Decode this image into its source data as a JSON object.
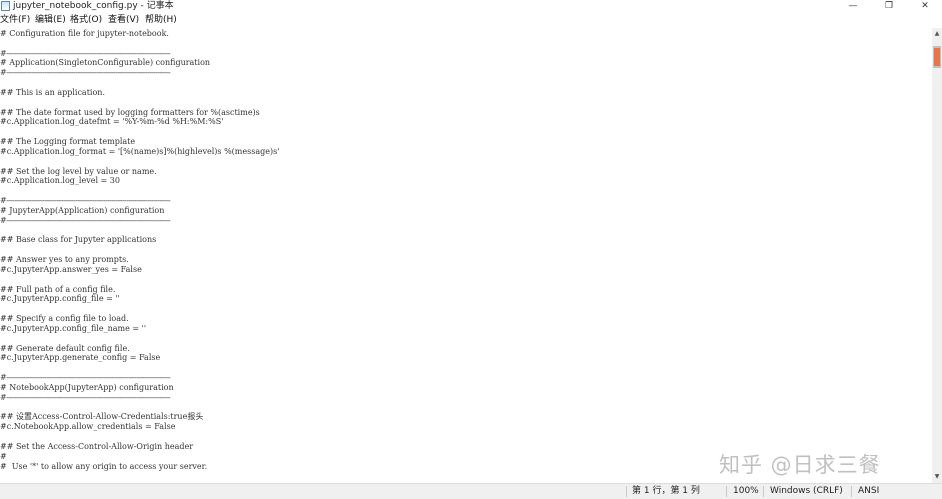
{
  "window": {
    "title": "jupyter_notebook_config.py - 记事本",
    "icon": "notepad-icon",
    "controls": {
      "minimize": "—",
      "maximize": "❐",
      "close": "✕"
    }
  },
  "menu": [
    {
      "label": "文件(F)"
    },
    {
      "label": "编辑(E)"
    },
    {
      "label": "格式(O)"
    },
    {
      "label": "查看(V)"
    },
    {
      "label": "帮助(H)"
    }
  ],
  "editor": {
    "lines": [
      "# Configuration file for jupyter-notebook.",
      "",
      "#------------------------------------------------------------------------------",
      "# Application(SingletonConfigurable) configuration",
      "#------------------------------------------------------------------------------",
      "",
      "## This is an application.",
      "",
      "## The date format used by logging formatters for %(asctime)s",
      "#c.Application.log_datefmt = '%Y-%m-%d %H:%M:%S'",
      "",
      "## The Logging format template",
      "#c.Application.log_format = '[%(name)s]%(highlevel)s %(message)s'",
      "",
      "## Set the log level by value or name.",
      "#c.Application.log_level = 30",
      "",
      "#------------------------------------------------------------------------------",
      "# JupyterApp(Application) configuration",
      "#------------------------------------------------------------------------------",
      "",
      "## Base class for Jupyter applications",
      "",
      "## Answer yes to any prompts.",
      "#c.JupyterApp.answer_yes = False",
      "",
      "## Full path of a config file.",
      "#c.JupyterApp.config_file = ''",
      "",
      "## Specify a config file to load.",
      "#c.JupyterApp.config_file_name = ''",
      "",
      "## Generate default config file.",
      "#c.JupyterApp.generate_config = False",
      "",
      "#------------------------------------------------------------------------------",
      "# NotebookApp(JupyterApp) configuration",
      "#------------------------------------------------------------------------------",
      "",
      "## 设置Access-Control-Allow-Credentials:true报头",
      "#c.NotebookApp.allow_credentials = False",
      "",
      "## Set the Access-Control-Allow-Origin header",
      "#",
      "#  Use '*' to allow any origin to access your server."
    ]
  },
  "scrollbar": {
    "up_arrow": "▲",
    "down_arrow": "▼"
  },
  "status": {
    "position": "第 1 行，第 1 列",
    "zoom": "100%",
    "line_ending": "Windows (CRLF)",
    "encoding": "ANSI"
  },
  "watermark": "知乎 @日求三餐"
}
